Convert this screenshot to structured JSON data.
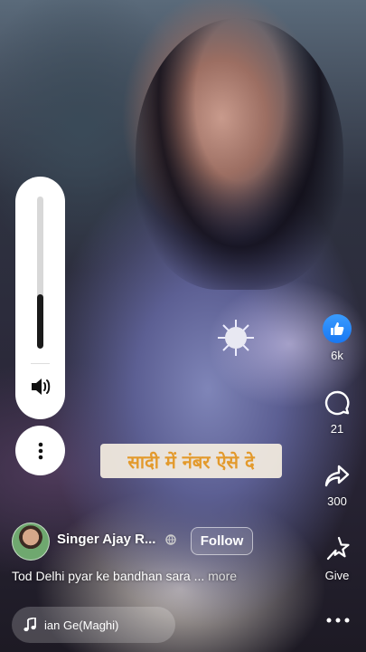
{
  "overlay": {
    "caption_text": "सादी में नंबर ऐसे दे"
  },
  "volume": {
    "level": 0.36
  },
  "actions": {
    "like_count": "6k",
    "comment_count": "21",
    "share_count": "300",
    "give_label": "Give"
  },
  "author": {
    "name": "Singer Ajay R...",
    "follow_label": "Follow"
  },
  "post": {
    "description": "Tod Delhi pyar ke bandhan sara ...",
    "more_label": "more"
  },
  "music": {
    "title": "ian Ge(Maghi)"
  },
  "colors": {
    "like_blue": "#1877f2",
    "caption_text": "#e39a2c"
  }
}
